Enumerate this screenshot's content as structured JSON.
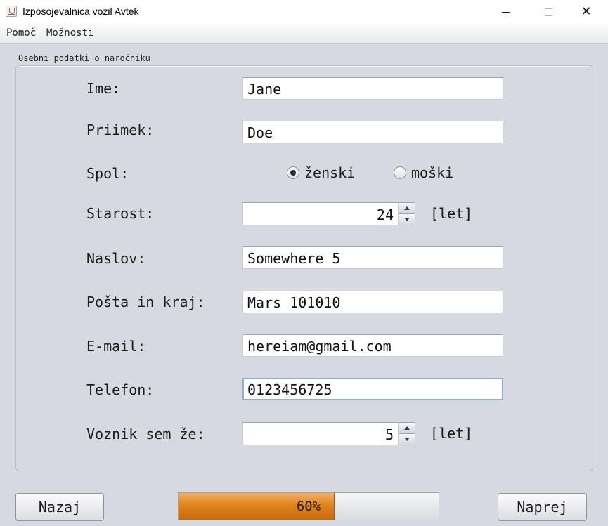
{
  "window": {
    "title": "Izposojevalnica vozil Avtek",
    "icon": "java-cup-icon"
  },
  "menu": {
    "items": [
      "Pomoč",
      "Možnosti"
    ]
  },
  "form": {
    "group_title": "Osebni podatki o naročniku",
    "first_name": {
      "label": "Ime:",
      "value": "Jane"
    },
    "last_name": {
      "label": "Priimek:",
      "value": "Doe"
    },
    "gender": {
      "label": "Spol:",
      "options": [
        "ženski",
        "moški"
      ],
      "selected": "ženski"
    },
    "age": {
      "label": "Starost:",
      "value": "24",
      "unit": "[let]"
    },
    "address": {
      "label": "Naslov:",
      "value": "Somewhere 5"
    },
    "post": {
      "label": "Pošta in kraj:",
      "value": "Mars 101010"
    },
    "email": {
      "label": "E-mail:",
      "value": "hereiam@gmail.com"
    },
    "phone": {
      "label": "Telefon:",
      "value": "0123456725"
    },
    "driver_years": {
      "label": "Voznik sem že:",
      "value": "5",
      "unit": "[let]"
    }
  },
  "footer": {
    "back_label": "Nazaj",
    "next_label": "Naprej",
    "progress": {
      "value": 0.6,
      "text": "60%"
    }
  },
  "colors": {
    "progress_fill": "#e0841a",
    "focus_border": "#8fb0d6"
  }
}
